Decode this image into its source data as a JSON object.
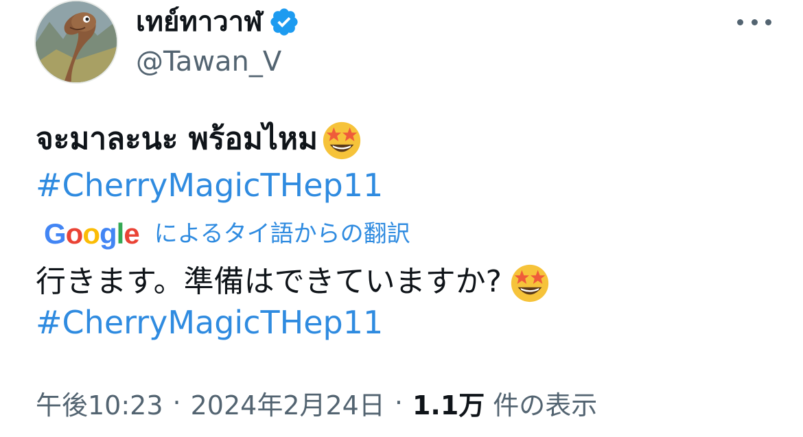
{
  "author": {
    "display_name": "เทย์ทาวาฬ",
    "handle": "@Tawan_V",
    "verified": true,
    "avatar_icon": "dinosaur-avatar-icon"
  },
  "tweet": {
    "text": "จะมาละนะ พร้อมไหม",
    "text_emoji": "star-struck-emoji",
    "hashtag": "#CherryMagicTHep11"
  },
  "translation": {
    "provider": "Google",
    "label": "によるタイ語からの翻訳",
    "text": "行きます。準備はできていますか?",
    "text_emoji": "star-struck-emoji",
    "hashtag": "#CherryMagicTHep11"
  },
  "meta": {
    "time": "午後10:23",
    "separator": "·",
    "date": "2024年2月24日",
    "views_count": "1.1万",
    "views_label": "件の表示"
  },
  "colors": {
    "link": "#2f8be0",
    "verified": "#1d9bf0",
    "secondary_text": "#536471",
    "primary_text": "#0f1419"
  }
}
